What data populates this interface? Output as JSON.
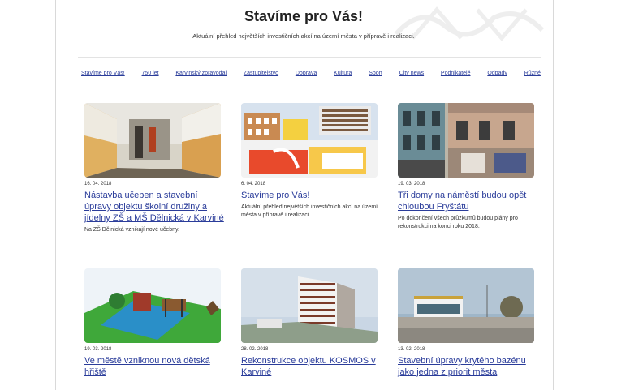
{
  "header": {
    "title": "Stavíme pro Vás!",
    "subtitle": "Aktuální přehled největších investičních akcí na území města v přípravě i realizaci."
  },
  "nav": {
    "items": [
      {
        "label": "Stavíme pro Vás!"
      },
      {
        "label": "750 let"
      },
      {
        "label": "Karvinský zpravodaj"
      },
      {
        "label": "Zastupitelstvo"
      },
      {
        "label": "Doprava"
      },
      {
        "label": "Kultura"
      },
      {
        "label": "Sport"
      },
      {
        "label": "City news"
      },
      {
        "label": "Podnikatelé"
      },
      {
        "label": "Odpady"
      },
      {
        "label": "Různé"
      }
    ]
  },
  "articles": [
    {
      "date": "16. 04. 2018",
      "title": "Nástavba učeben a stavební úpravy objektu školní družiny a jídelny ZŠ a MŠ Dělnická v Karviné",
      "desc": "Na ZŠ Dělnická vznikají nové učebny.",
      "image": "school-corridor-photo"
    },
    {
      "date": "6. 04. 2018",
      "title": "Stavíme pro Vás!",
      "desc": "Aktuální přehled největších investičních akcí na území města v přípravě i realizaci.",
      "image": "building-collage-render"
    },
    {
      "date": "19. 03. 2018",
      "title": "Tři domy na náměstí budou opět chloubou Fryštátu",
      "desc": "Po dokončení všech průzkumů budou plány pro rekonstrukci na konci roku 2018.",
      "image": "square-houses-photo"
    },
    {
      "date": "19. 03. 2018",
      "title": "Ve městě vzniknou nová dětská hřiště",
      "desc": "",
      "image": "playground-render"
    },
    {
      "date": "28. 02. 2018",
      "title": "Rekonstrukce objektu KOSMOS v Karviné",
      "desc": "",
      "image": "kosmos-building-render"
    },
    {
      "date": "13. 02. 2018",
      "title": "Stavební úpravy krytého bazénu jako jedna z priorit města",
      "desc": "",
      "image": "swimming-pool-photo"
    }
  ]
}
